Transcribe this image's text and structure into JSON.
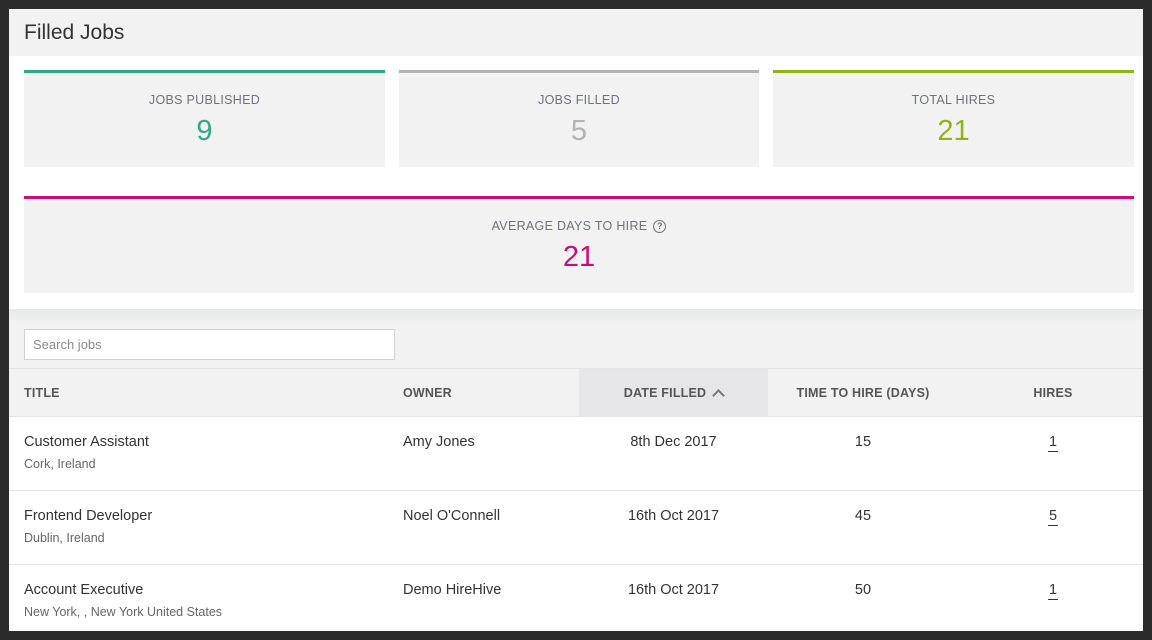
{
  "page": {
    "title": "Filled Jobs"
  },
  "stats": {
    "jobs_published": {
      "label": "JOBS PUBLISHED",
      "value": "9",
      "color": "#2fa886"
    },
    "jobs_filled": {
      "label": "JOBS FILLED",
      "value": "5",
      "color": "#b3b3b3"
    },
    "total_hires": {
      "label": "TOTAL HIRES",
      "value": "21",
      "color": "#8db516"
    },
    "avg_days": {
      "label": "AVERAGE DAYS TO HIRE",
      "value": "21",
      "color": "#cc0e7a",
      "icon": "help-icon"
    }
  },
  "search": {
    "placeholder": "Search jobs",
    "value": ""
  },
  "table": {
    "headers": {
      "title": "TITLE",
      "owner": "OWNER",
      "date_filled": "DATE FILLED",
      "time_to_hire": "TIME TO HIRE (DAYS)",
      "hires": "HIRES"
    },
    "sort": {
      "column": "date_filled",
      "direction": "desc",
      "icon": "chevron-up-icon"
    },
    "rows": [
      {
        "title": "Customer Assistant",
        "location": "Cork, Ireland",
        "owner": "Amy Jones",
        "date_filled": "8th Dec 2017",
        "time_to_hire": "15",
        "hires": "1"
      },
      {
        "title": "Frontend Developer",
        "location": "Dublin, Ireland",
        "owner": "Noel O'Connell",
        "date_filled": "16th Oct 2017",
        "time_to_hire": "45",
        "hires": "5"
      },
      {
        "title": "Account Executive",
        "location": "New York, , New York United States",
        "owner": "Demo HireHive",
        "date_filled": "16th Oct 2017",
        "time_to_hire": "50",
        "hires": "1"
      }
    ]
  }
}
